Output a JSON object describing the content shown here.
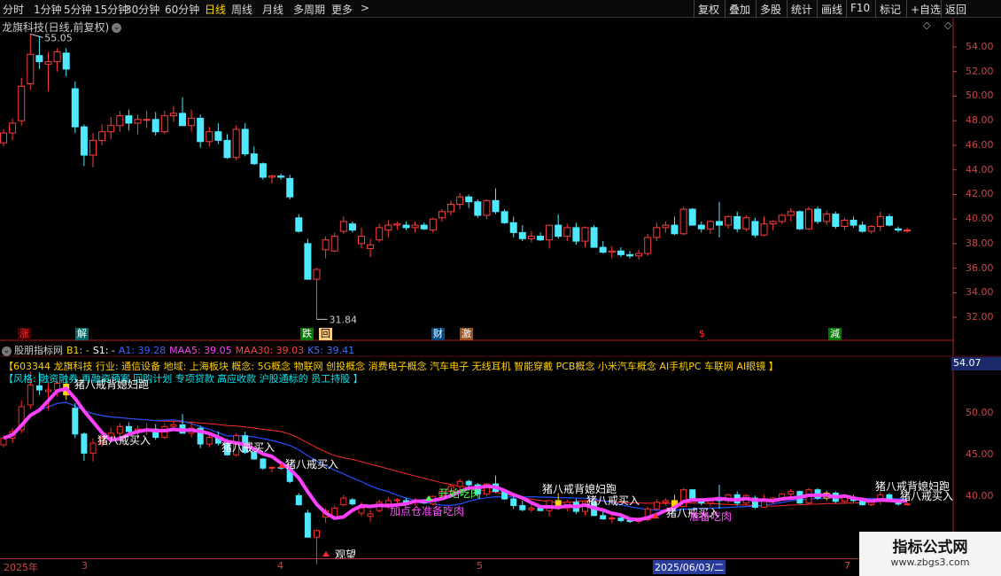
{
  "toolbar": {
    "periods": [
      "分时",
      "1分钟",
      "5分钟",
      "15分钟",
      "30分钟",
      "60分钟",
      "日线",
      "周线",
      "月线",
      "多周期",
      "更多"
    ],
    "active_period": "日线",
    "more_arrow": ">",
    "right_buttons": [
      "复权",
      "叠加",
      "多股",
      "统计",
      "画线",
      "F10",
      "标记",
      "+自选",
      "返回"
    ]
  },
  "upper": {
    "title": "龙旗科技(日线,前复权)",
    "title_icon": "⌄",
    "diamond_icons": "◇ ◇",
    "high_label": "55.05",
    "low_label": "31.84",
    "y_ticks": [
      "54.00",
      "52.00",
      "50.00",
      "48.00",
      "46.00",
      "44.00",
      "42.00",
      "40.00",
      "38.00",
      "36.00",
      "34.00",
      "32.00"
    ],
    "y_range": [
      31.0,
      55.8
    ],
    "up_color": "#ff3d3d",
    "down_color": "#4ee8ff"
  },
  "events": [
    {
      "text": "涨",
      "fg": "#ff3030",
      "bg": "#4a0000"
    },
    {
      "text": "解",
      "fg": "#ffffff",
      "bg": "#006a6a"
    },
    {
      "text": "跌",
      "fg": "#ffffff",
      "bg": "#007a00"
    },
    {
      "text": "回",
      "fg": "#000000",
      "bg": "#ffd080"
    },
    {
      "text": "财",
      "fg": "#ffffff",
      "bg": "#004a8a"
    },
    {
      "text": "激",
      "fg": "#ffffff",
      "bg": "#a05020"
    },
    {
      "text": "$",
      "fg": "#ff3030",
      "bg": "#000000"
    },
    {
      "text": "減",
      "fg": "#ffffff",
      "bg": "#007a00"
    }
  ],
  "lower": {
    "title": "股朋指标网",
    "b1": "B1: -",
    "s1": "S1: -",
    "a1": "A1: 39.28",
    "maa5": "MAA5: 39.05",
    "maa30": "MAA30: 39.03",
    "k5": "K5: 39.41",
    "info_line1": "【603344 龙旗科技 行业: 通信设备 地域: 上海板块 概念: 5G概念 物联网 创投概念 消费电子概念 汽车电子 无线耳机 智能穿戴 PCB概念 小米汽车概念 AI手机PC 车联网 AI眼镜 】",
    "info_line2": "【风格: 融资融券 再融资预案 回购计划 专项贷款 高应收款 沪股通标的 员工持股 】",
    "price_badge": "54.07",
    "y_ticks": [
      "50.00",
      "45.00",
      "40.00",
      "35.00"
    ],
    "labels": {
      "zbxfp_1": "猪八戒背媳妇跑",
      "zbjmr_1": "猪八戒买入",
      "zbjmr_2": "猪八戒买入",
      "zbjmr_3": "猪八戒买入",
      "jdc": "加点仓准备吃肉",
      "ks": "开始吃肉",
      "zbxfp_2": "猪八戒背媳妇跑",
      "zbjmr_4": "猪八戒买入",
      "zbjmr_5": "猪八戒买入",
      "zbcr": "准备吃肉",
      "zbxfp_3": "猪八戒背媳妇跑",
      "zbjmr_6": "猪八戒买入",
      "gw": "观望"
    }
  },
  "dates": {
    "labels": [
      "2025年",
      "3",
      "4",
      "5",
      "2025/06/03/二",
      "7"
    ],
    "cursor": "2025/06/03/二"
  },
  "watermark": {
    "line1": "指标公式网",
    "line2": "www.zbgs3.com"
  },
  "chart_data": {
    "type": "candlestick",
    "title": "龙旗科技(日线,前复权)",
    "ylim": [
      31.0,
      55.8
    ],
    "ohlc": [
      [
        46.2,
        47.3,
        45.9,
        47.0
      ],
      [
        47.0,
        48.2,
        46.4,
        47.8
      ],
      [
        48.0,
        51.5,
        47.6,
        50.8
      ],
      [
        51.0,
        55.05,
        50.5,
        53.4
      ],
      [
        53.3,
        54.9,
        52.2,
        52.8
      ],
      [
        52.6,
        53.6,
        50.4,
        52.8
      ],
      [
        52.8,
        53.9,
        52.0,
        53.6
      ],
      [
        53.5,
        53.9,
        51.6,
        52.2
      ],
      [
        50.6,
        51.2,
        47.0,
        47.5
      ],
      [
        47.5,
        47.7,
        44.3,
        45.2
      ],
      [
        45.2,
        47.0,
        44.2,
        46.4
      ],
      [
        46.4,
        47.7,
        46.0,
        47.1
      ],
      [
        47.1,
        48.3,
        46.5,
        47.6
      ],
      [
        47.6,
        48.8,
        47.1,
        48.4
      ],
      [
        48.4,
        48.9,
        47.2,
        47.8
      ],
      [
        47.8,
        48.5,
        46.9,
        48.1
      ],
      [
        48.1,
        48.8,
        47.4,
        48.1
      ],
      [
        48.1,
        48.7,
        46.8,
        47.1
      ],
      [
        47.1,
        48.8,
        46.9,
        48.4
      ],
      [
        48.4,
        49.2,
        47.9,
        48.6
      ],
      [
        48.6,
        49.9,
        47.7,
        47.6
      ],
      [
        47.6,
        48.9,
        47.1,
        48.2
      ],
      [
        48.2,
        48.5,
        45.8,
        46.3
      ],
      [
        46.3,
        47.5,
        45.9,
        47.1
      ],
      [
        47.1,
        47.8,
        46.1,
        46.4
      ],
      [
        46.4,
        46.9,
        44.9,
        45.0
      ],
      [
        45.0,
        47.6,
        44.8,
        47.3
      ],
      [
        47.3,
        47.8,
        45.1,
        45.3
      ],
      [
        45.3,
        45.9,
        44.4,
        44.5
      ],
      [
        44.5,
        44.6,
        43.2,
        43.4
      ],
      [
        43.4,
        43.6,
        42.9,
        43.5
      ],
      [
        43.5,
        43.7,
        43.2,
        43.4
      ],
      [
        43.3,
        43.6,
        41.6,
        41.8
      ],
      [
        40.1,
        40.4,
        38.9,
        39.0
      ],
      [
        38.0,
        38.4,
        35.2,
        35.1
      ],
      [
        35.1,
        36.0,
        31.84,
        35.9
      ],
      [
        37.5,
        38.6,
        36.8,
        38.3
      ],
      [
        37.4,
        38.9,
        37.3,
        38.6
      ],
      [
        39.0,
        40.2,
        38.8,
        39.8
      ],
      [
        39.6,
        39.8,
        38.9,
        39.1
      ],
      [
        38.0,
        39.3,
        37.6,
        38.6
      ],
      [
        37.6,
        38.4,
        36.9,
        37.9
      ],
      [
        38.3,
        39.6,
        38.1,
        39.3
      ],
      [
        39.1,
        39.9,
        38.5,
        39.5
      ],
      [
        39.5,
        39.8,
        39.1,
        39.6
      ],
      [
        39.5,
        39.8,
        39.1,
        39.3
      ],
      [
        39.3,
        39.8,
        38.9,
        39.5
      ],
      [
        39.5,
        39.7,
        39.1,
        39.2
      ],
      [
        39.1,
        40.1,
        38.9,
        40.0
      ],
      [
        40.1,
        40.8,
        39.8,
        40.6
      ],
      [
        40.6,
        41.5,
        40.3,
        41.2
      ],
      [
        41.2,
        42.1,
        40.8,
        41.8
      ],
      [
        41.8,
        42.0,
        40.9,
        41.4
      ],
      [
        41.4,
        41.6,
        40.1,
        40.3
      ],
      [
        40.3,
        41.6,
        40.0,
        41.5
      ],
      [
        41.5,
        42.5,
        40.4,
        40.6
      ],
      [
        40.6,
        40.8,
        39.6,
        39.7
      ],
      [
        39.7,
        40.2,
        38.5,
        38.9
      ],
      [
        38.9,
        39.5,
        38.2,
        38.4
      ],
      [
        38.4,
        39.0,
        38.1,
        38.6
      ],
      [
        38.6,
        38.9,
        38.2,
        38.3
      ],
      [
        38.3,
        39.3,
        37.6,
        39.5
      ],
      [
        39.5,
        40.4,
        38.4,
        38.6
      ],
      [
        38.6,
        39.6,
        38.2,
        39.3
      ],
      [
        39.3,
        39.7,
        37.9,
        38.2
      ],
      [
        38.2,
        39.4,
        37.7,
        39.3
      ],
      [
        39.3,
        39.5,
        38.0,
        37.7
      ],
      [
        37.7,
        38.2,
        37.2,
        37.3
      ],
      [
        37.3,
        37.8,
        36.8,
        37.4
      ],
      [
        37.4,
        37.7,
        36.9,
        37.1
      ],
      [
        37.1,
        37.4,
        36.8,
        37.0
      ],
      [
        37.0,
        37.5,
        36.7,
        37.2
      ],
      [
        37.2,
        38.8,
        37.0,
        38.5
      ],
      [
        38.5,
        39.7,
        38.2,
        39.3
      ],
      [
        39.3,
        39.8,
        38.9,
        39.5
      ],
      [
        39.5,
        40.2,
        38.7,
        38.8
      ],
      [
        38.8,
        41.0,
        38.7,
        40.8
      ],
      [
        40.8,
        40.9,
        39.5,
        39.5
      ],
      [
        39.5,
        39.8,
        38.9,
        39.2
      ],
      [
        39.2,
        39.9,
        38.8,
        39.8
      ],
      [
        39.8,
        41.4,
        38.5,
        39.5
      ],
      [
        39.5,
        40.3,
        39.2,
        40.2
      ],
      [
        40.2,
        40.6,
        38.9,
        39.2
      ],
      [
        39.2,
        40.3,
        39.0,
        40.1
      ],
      [
        39.8,
        40.1,
        38.5,
        38.7
      ],
      [
        38.7,
        40.2,
        38.6,
        39.6
      ],
      [
        39.6,
        39.9,
        39.1,
        39.8
      ],
      [
        39.8,
        40.4,
        39.6,
        40.3
      ],
      [
        40.3,
        40.9,
        39.8,
        40.6
      ],
      [
        40.6,
        40.7,
        39.1,
        39.2
      ],
      [
        39.2,
        41.0,
        39.1,
        40.8
      ],
      [
        40.8,
        41.0,
        39.6,
        39.8
      ],
      [
        39.8,
        40.7,
        39.5,
        40.4
      ],
      [
        40.4,
        40.6,
        39.2,
        39.4
      ],
      [
        39.4,
        40.1,
        39.1,
        39.9
      ],
      [
        39.9,
        40.2,
        39.3,
        39.5
      ],
      [
        39.5,
        39.8,
        38.9,
        39.0
      ],
      [
        39.0,
        39.5,
        38.8,
        39.4
      ],
      [
        39.4,
        40.6,
        39.0,
        40.2
      ],
      [
        40.2,
        40.4,
        39.4,
        39.5
      ],
      [
        39.2,
        39.4,
        38.9,
        39.1
      ],
      [
        39.1,
        39.3,
        38.9,
        39.1
      ]
    ],
    "markers": {
      "high": 55.05,
      "low": 31.84
    }
  }
}
